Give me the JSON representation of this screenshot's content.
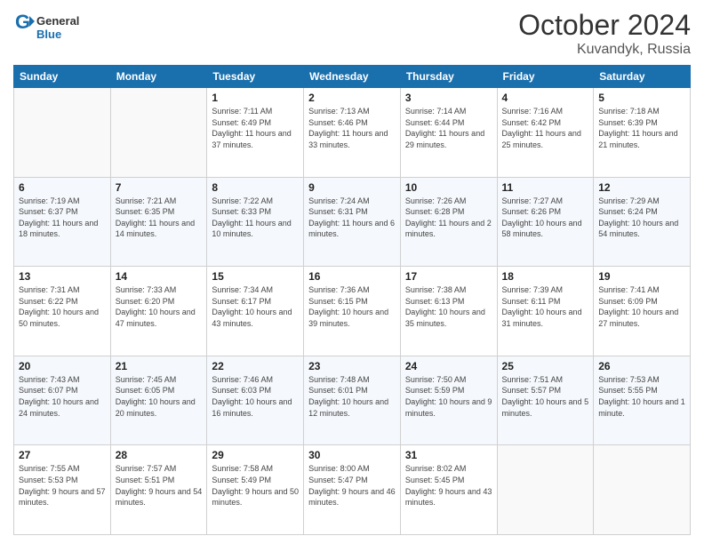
{
  "header": {
    "logo_general": "General",
    "logo_blue": "Blue",
    "month": "October 2024",
    "location": "Kuvandyk, Russia"
  },
  "weekdays": [
    "Sunday",
    "Monday",
    "Tuesday",
    "Wednesday",
    "Thursday",
    "Friday",
    "Saturday"
  ],
  "weeks": [
    [
      {
        "day": "",
        "info": ""
      },
      {
        "day": "",
        "info": ""
      },
      {
        "day": "1",
        "info": "Sunrise: 7:11 AM\nSunset: 6:49 PM\nDaylight: 11 hours and 37 minutes."
      },
      {
        "day": "2",
        "info": "Sunrise: 7:13 AM\nSunset: 6:46 PM\nDaylight: 11 hours and 33 minutes."
      },
      {
        "day": "3",
        "info": "Sunrise: 7:14 AM\nSunset: 6:44 PM\nDaylight: 11 hours and 29 minutes."
      },
      {
        "day": "4",
        "info": "Sunrise: 7:16 AM\nSunset: 6:42 PM\nDaylight: 11 hours and 25 minutes."
      },
      {
        "day": "5",
        "info": "Sunrise: 7:18 AM\nSunset: 6:39 PM\nDaylight: 11 hours and 21 minutes."
      }
    ],
    [
      {
        "day": "6",
        "info": "Sunrise: 7:19 AM\nSunset: 6:37 PM\nDaylight: 11 hours and 18 minutes."
      },
      {
        "day": "7",
        "info": "Sunrise: 7:21 AM\nSunset: 6:35 PM\nDaylight: 11 hours and 14 minutes."
      },
      {
        "day": "8",
        "info": "Sunrise: 7:22 AM\nSunset: 6:33 PM\nDaylight: 11 hours and 10 minutes."
      },
      {
        "day": "9",
        "info": "Sunrise: 7:24 AM\nSunset: 6:31 PM\nDaylight: 11 hours and 6 minutes."
      },
      {
        "day": "10",
        "info": "Sunrise: 7:26 AM\nSunset: 6:28 PM\nDaylight: 11 hours and 2 minutes."
      },
      {
        "day": "11",
        "info": "Sunrise: 7:27 AM\nSunset: 6:26 PM\nDaylight: 10 hours and 58 minutes."
      },
      {
        "day": "12",
        "info": "Sunrise: 7:29 AM\nSunset: 6:24 PM\nDaylight: 10 hours and 54 minutes."
      }
    ],
    [
      {
        "day": "13",
        "info": "Sunrise: 7:31 AM\nSunset: 6:22 PM\nDaylight: 10 hours and 50 minutes."
      },
      {
        "day": "14",
        "info": "Sunrise: 7:33 AM\nSunset: 6:20 PM\nDaylight: 10 hours and 47 minutes."
      },
      {
        "day": "15",
        "info": "Sunrise: 7:34 AM\nSunset: 6:17 PM\nDaylight: 10 hours and 43 minutes."
      },
      {
        "day": "16",
        "info": "Sunrise: 7:36 AM\nSunset: 6:15 PM\nDaylight: 10 hours and 39 minutes."
      },
      {
        "day": "17",
        "info": "Sunrise: 7:38 AM\nSunset: 6:13 PM\nDaylight: 10 hours and 35 minutes."
      },
      {
        "day": "18",
        "info": "Sunrise: 7:39 AM\nSunset: 6:11 PM\nDaylight: 10 hours and 31 minutes."
      },
      {
        "day": "19",
        "info": "Sunrise: 7:41 AM\nSunset: 6:09 PM\nDaylight: 10 hours and 27 minutes."
      }
    ],
    [
      {
        "day": "20",
        "info": "Sunrise: 7:43 AM\nSunset: 6:07 PM\nDaylight: 10 hours and 24 minutes."
      },
      {
        "day": "21",
        "info": "Sunrise: 7:45 AM\nSunset: 6:05 PM\nDaylight: 10 hours and 20 minutes."
      },
      {
        "day": "22",
        "info": "Sunrise: 7:46 AM\nSunset: 6:03 PM\nDaylight: 10 hours and 16 minutes."
      },
      {
        "day": "23",
        "info": "Sunrise: 7:48 AM\nSunset: 6:01 PM\nDaylight: 10 hours and 12 minutes."
      },
      {
        "day": "24",
        "info": "Sunrise: 7:50 AM\nSunset: 5:59 PM\nDaylight: 10 hours and 9 minutes."
      },
      {
        "day": "25",
        "info": "Sunrise: 7:51 AM\nSunset: 5:57 PM\nDaylight: 10 hours and 5 minutes."
      },
      {
        "day": "26",
        "info": "Sunrise: 7:53 AM\nSunset: 5:55 PM\nDaylight: 10 hours and 1 minute."
      }
    ],
    [
      {
        "day": "27",
        "info": "Sunrise: 7:55 AM\nSunset: 5:53 PM\nDaylight: 9 hours and 57 minutes."
      },
      {
        "day": "28",
        "info": "Sunrise: 7:57 AM\nSunset: 5:51 PM\nDaylight: 9 hours and 54 minutes."
      },
      {
        "day": "29",
        "info": "Sunrise: 7:58 AM\nSunset: 5:49 PM\nDaylight: 9 hours and 50 minutes."
      },
      {
        "day": "30",
        "info": "Sunrise: 8:00 AM\nSunset: 5:47 PM\nDaylight: 9 hours and 46 minutes."
      },
      {
        "day": "31",
        "info": "Sunrise: 8:02 AM\nSunset: 5:45 PM\nDaylight: 9 hours and 43 minutes."
      },
      {
        "day": "",
        "info": ""
      },
      {
        "day": "",
        "info": ""
      }
    ]
  ]
}
